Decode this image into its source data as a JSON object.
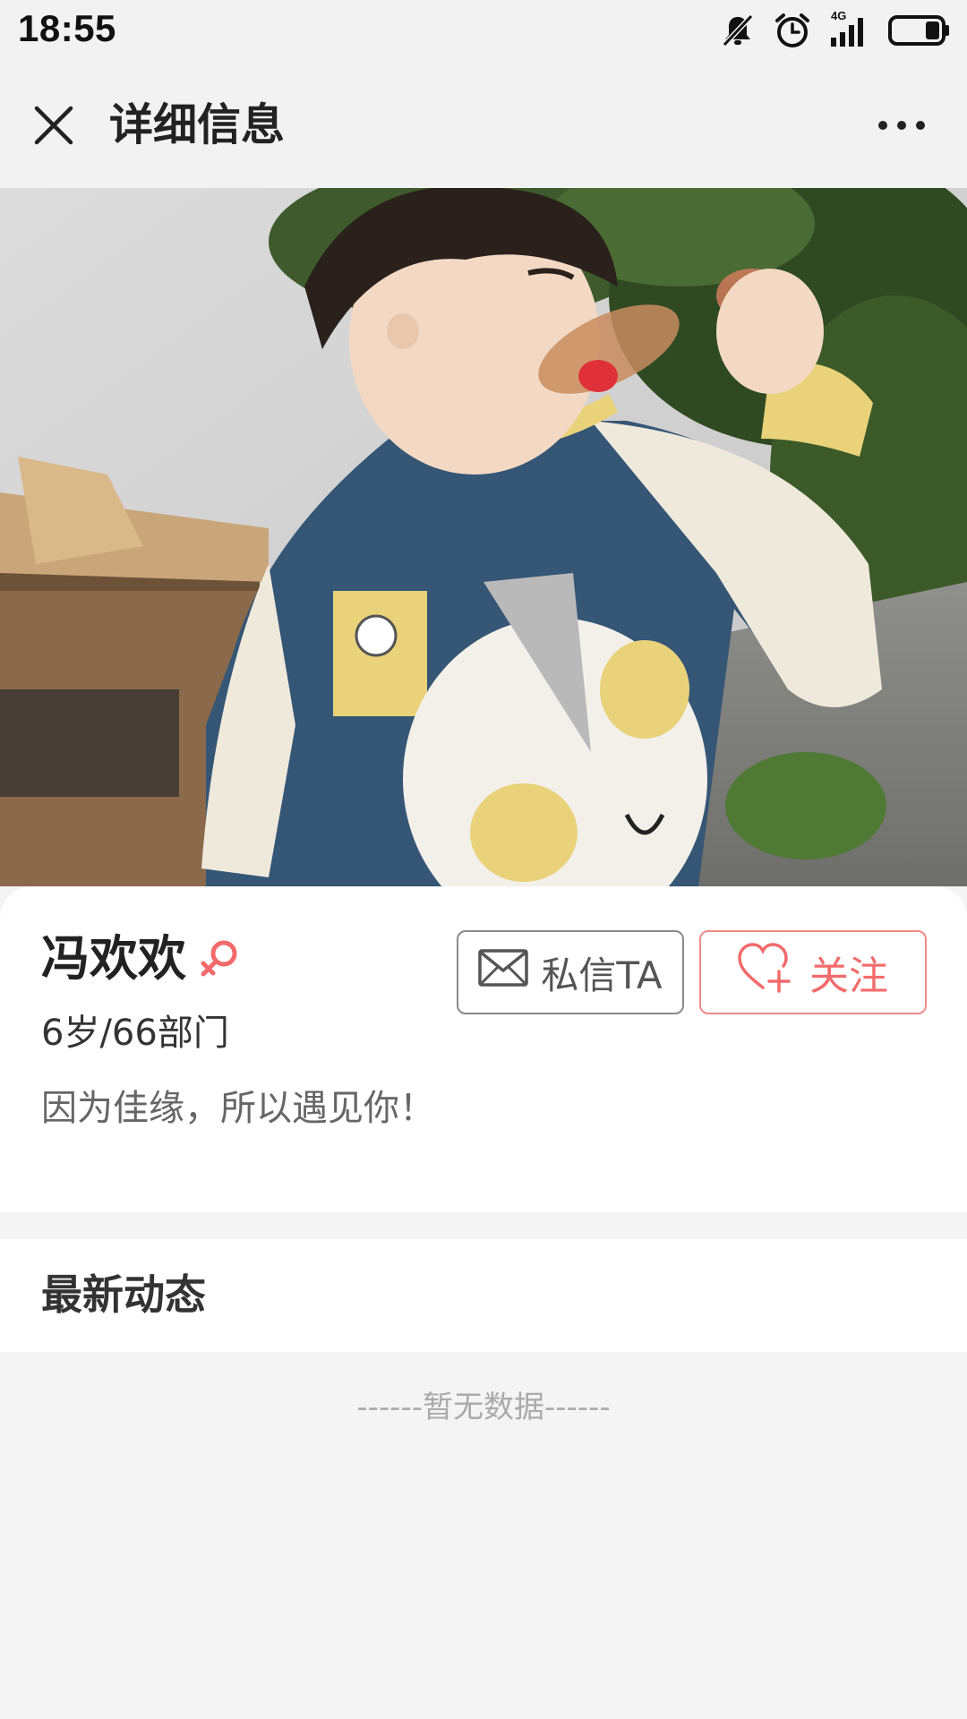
{
  "status_bar": {
    "time": "18:55",
    "network_label": "4G",
    "icons": [
      "bell-muted-icon",
      "alarm-icon",
      "signal-4g-icon",
      "battery-icon"
    ]
  },
  "header": {
    "title": "详细信息",
    "close_icon": "close-icon",
    "more_icon": "more-icon"
  },
  "cover": {
    "image": "profile-cover-photo"
  },
  "profile": {
    "name": "冯欢欢",
    "gender_icon": "female-icon",
    "gender_color": "#f26b6b",
    "meta": "6岁/66部门",
    "bio": "因为佳缘，所以遇见你！",
    "message_button": "私信TA",
    "follow_button": "关注",
    "accent_color": "#f26b6b"
  },
  "feed": {
    "section_title": "最新动态",
    "empty_text": "------暂无数据------"
  }
}
